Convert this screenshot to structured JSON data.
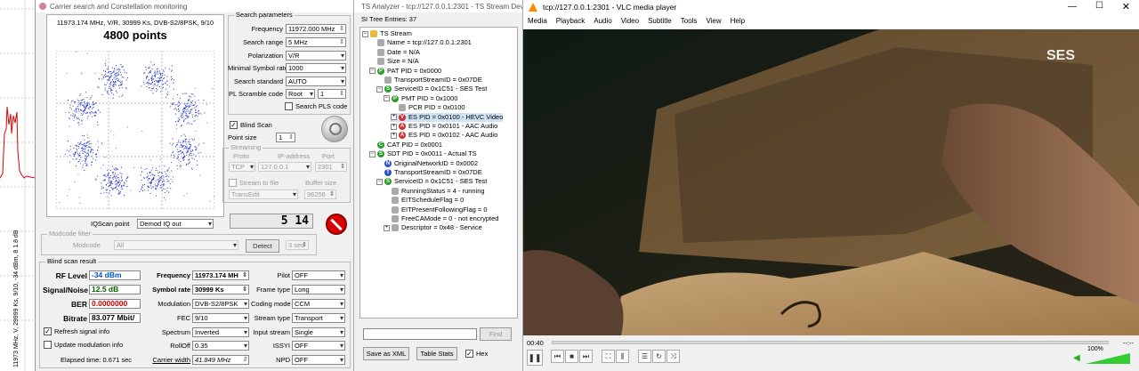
{
  "spectrum": {
    "vertical_label": "11973 MHz, V, 29999 Ks, 9/10, -34 dBm, 8 1.8 dB"
  },
  "carrier": {
    "title": "Carrier search and Constellation monitoring",
    "const_info": "11973.174 MHz, V/R, 30999 Ks, DVB-S2/8PSK, 9/10",
    "points": "4800 points",
    "search": {
      "group": "Search parameters",
      "freq_label": "Frequency",
      "freq": "11972.000 MHz",
      "range_label": "Search range",
      "range": "5 MHz",
      "pol_label": "Polarization",
      "pol": "V/R",
      "msr_label": "Minimal Symbol rate",
      "msr": "1000",
      "std_label": "Search standard",
      "std": "AUTO",
      "pls_label": "PL Scramble code",
      "pls_mode": "Root",
      "pls_val": "1",
      "search_pls": "Search PLS code"
    },
    "blind_scan": "Blind Scan",
    "point_size_label": "Point size",
    "point_size": "1",
    "streaming": {
      "group": "Streaming",
      "proto_h": "Proto",
      "ip_h": "IP-address",
      "port_h": "Port",
      "proto": "TCP",
      "ip": "127.0.0.1",
      "port": "2301",
      "stream_to_file": "Stream to file",
      "buffer_h": "Buffer size",
      "file": "TransEdit",
      "buffer": "96256"
    },
    "iqscan_label": "IQScan point",
    "iqscan": "Demod IQ out",
    "signal_value": "5 14",
    "modcode": {
      "group": "Modcode filter",
      "label": "Modcode",
      "value": "All",
      "detect": "Detect",
      "sec": "3 sec"
    },
    "result": {
      "group": "Blind scan result",
      "rf_label": "RF Level",
      "rf": "-34 dBm",
      "sn_label": "Signal/Noise",
      "sn": "12.5 dB",
      "ber_label": "BER",
      "ber": "0.0000000",
      "bitrate_label": "Bitrate",
      "bitrate": "83.077 Mbit/",
      "freq_label": "Frequency",
      "freq": "11973.174 MH",
      "sr_label": "Symbol rate",
      "sr": "30999 Ks",
      "mod_label": "Modulation",
      "mod": "DVB-S2/8PSK",
      "fec_label": "FEC",
      "fec": "9/10",
      "spectrum_label": "Spectrum",
      "spectrum": "Inverted",
      "rolloff_label": "RollOff",
      "rolloff": "0.35",
      "carrier_label": "Carrier width",
      "carrier": "41.849 MHz",
      "pilot_label": "Pilot",
      "pilot": "OFF",
      "frame_label": "Frame type",
      "frame": "Long",
      "coding_label": "Coding mode",
      "coding": "CCM",
      "stype_label": "Stream type",
      "stype": "Transport",
      "input_label": "Input stream",
      "input": "Single",
      "issyi_label": "ISSYI",
      "issyi": "OFF",
      "npd_label": "NPD",
      "npd": "OFF"
    },
    "refresh": "Refresh signal info",
    "update_mod": "Update modulation info",
    "elapsed": "Elapsed time: 0.671 sec"
  },
  "ts": {
    "title": "TS Analyzer - tcp://127.0.0.1:2301 - TS Stream Devi",
    "entries": "SI Tree Entries: 37",
    "rows": [
      {
        "t": "TS Stream",
        "l": 0,
        "i": "folder"
      },
      {
        "t": "Name = tcp://127.0.0.1:2301",
        "l": 1,
        "i": "leaf"
      },
      {
        "t": "Date = N/A",
        "l": 1,
        "i": "leaf"
      },
      {
        "t": "Size = N/A",
        "l": 1,
        "i": "leaf"
      },
      {
        "t": "PAT PID = 0x0000",
        "l": 1,
        "i": "P"
      },
      {
        "t": "TransportStreamID = 0x07DE",
        "l": 2,
        "i": "leaf"
      },
      {
        "t": "ServiceID = 0x1C51 - SES Test",
        "l": 2,
        "i": "S"
      },
      {
        "t": "PMT PID = 0x1000",
        "l": 3,
        "i": "P"
      },
      {
        "t": "PCR PID = 0x0100",
        "l": 4,
        "i": "leaf"
      },
      {
        "t": "ES PID = 0x0100 - HEVC Video",
        "l": 4,
        "i": "V"
      },
      {
        "t": "ES PID = 0x0101 - AAC Audio",
        "l": 4,
        "i": "A"
      },
      {
        "t": "ES PID = 0x0102 - AAC Audio",
        "l": 4,
        "i": "A"
      },
      {
        "t": "CAT PID = 0x0001",
        "l": 1,
        "i": "C"
      },
      {
        "t": "SDT PID = 0x0011 - Actual TS",
        "l": 1,
        "i": "S"
      },
      {
        "t": "OriginalNetworkID = 0x0002",
        "l": 2,
        "i": "N"
      },
      {
        "t": "TransportStreamID = 0x07DE",
        "l": 2,
        "i": "T"
      },
      {
        "t": "ServiceID = 0x1C51 - SES Test",
        "l": 2,
        "i": "S"
      },
      {
        "t": "RunningStatus = 4 - running",
        "l": 3,
        "i": "leaf"
      },
      {
        "t": "EITScheduleFlag = 0",
        "l": 3,
        "i": "leaf"
      },
      {
        "t": "EITPresentFollowingFlag = 0",
        "l": 3,
        "i": "leaf"
      },
      {
        "t": "FreeCAMode = 0 - not encrypted",
        "l": 3,
        "i": "leaf"
      },
      {
        "t": "Descriptor = 0x48 - Service",
        "l": 3,
        "i": "leaf"
      }
    ],
    "find": "Find",
    "save_xml": "Save as XML",
    "table_stats": "Table Stats",
    "hex": "Hex"
  },
  "vlc": {
    "title": "tcp://127.0.0.1:2301 - VLC media player",
    "menu": [
      "Media",
      "Playback",
      "Audio",
      "Video",
      "Subtitle",
      "Tools",
      "View",
      "Help"
    ],
    "time_left": "00:40",
    "time_right": "--:--",
    "volume": "100%",
    "volume_level": 1.0,
    "logo": "SES"
  }
}
